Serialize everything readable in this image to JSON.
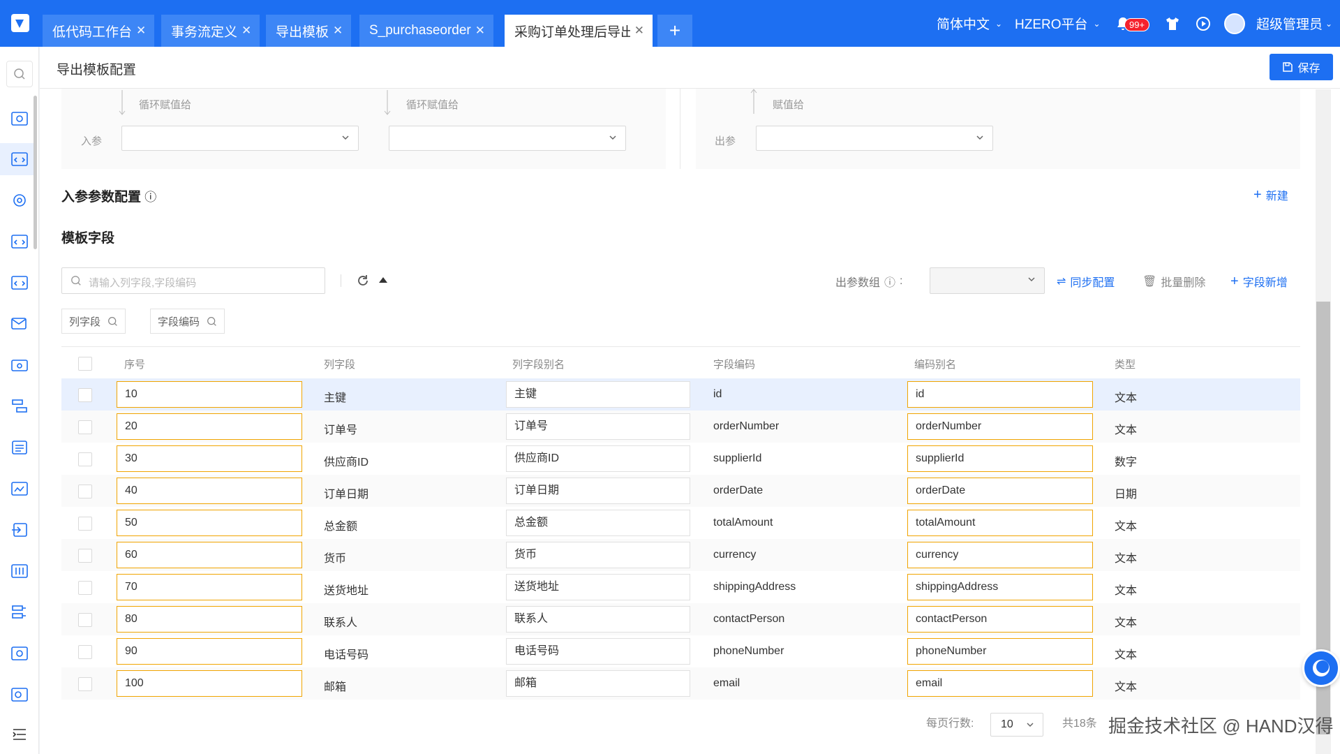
{
  "topbar": {
    "tabs": [
      {
        "label": "低代码工作台"
      },
      {
        "label": "事务流定义"
      },
      {
        "label": "导出模板"
      },
      {
        "label": "S_purchaseorder"
      },
      {
        "label": "采购订单处理后导出"
      }
    ],
    "language": "简体中文",
    "platform": "HZERO平台",
    "notification_count": "99+",
    "user": "超级管理员"
  },
  "header": {
    "title": "导出模板配置",
    "save_label": "保存"
  },
  "mapping": {
    "loop_assign_1": "循环赋值给",
    "loop_assign_2": "循环赋值给",
    "assign": "赋值给",
    "in_param": "入参",
    "out_param": "出参"
  },
  "in_params": {
    "title": "入参参数配置",
    "new_label": "新建"
  },
  "template_fields": {
    "title": "模板字段",
    "search_placeholder": "请输入列字段,字段编码",
    "output_group_label": "出参数组",
    "sync_label": "同步配置",
    "batch_delete_label": "批量删除",
    "add_field_label": "字段新增",
    "filter_chips": [
      "列字段",
      "字段编码"
    ],
    "columns": [
      "序号",
      "列字段",
      "列字段别名",
      "字段编码",
      "编码别名",
      "类型"
    ],
    "rows": [
      {
        "seq": "10",
        "col": "主键",
        "alias": "主键",
        "code": "id",
        "code_alias": "id",
        "type": "文本"
      },
      {
        "seq": "20",
        "col": "订单号",
        "alias": "订单号",
        "code": "orderNumber",
        "code_alias": "orderNumber",
        "type": "文本"
      },
      {
        "seq": "30",
        "col": "供应商ID",
        "alias": "供应商ID",
        "code": "supplierId",
        "code_alias": "supplierId",
        "type": "数字"
      },
      {
        "seq": "40",
        "col": "订单日期",
        "alias": "订单日期",
        "code": "orderDate",
        "code_alias": "orderDate",
        "type": "日期"
      },
      {
        "seq": "50",
        "col": "总金额",
        "alias": "总金额",
        "code": "totalAmount",
        "code_alias": "totalAmount",
        "type": "文本"
      },
      {
        "seq": "60",
        "col": "货币",
        "alias": "货币",
        "code": "currency",
        "code_alias": "currency",
        "type": "文本"
      },
      {
        "seq": "70",
        "col": "送货地址",
        "alias": "送货地址",
        "code": "shippingAddress",
        "code_alias": "shippingAddress",
        "type": "文本"
      },
      {
        "seq": "80",
        "col": "联系人",
        "alias": "联系人",
        "code": "contactPerson",
        "code_alias": "contactPerson",
        "type": "文本"
      },
      {
        "seq": "90",
        "col": "电话号码",
        "alias": "电话号码",
        "code": "phoneNumber",
        "code_alias": "phoneNumber",
        "type": "文本"
      },
      {
        "seq": "100",
        "col": "邮箱",
        "alias": "邮箱",
        "code": "email",
        "code_alias": "email",
        "type": "文本"
      }
    ]
  },
  "pager": {
    "rows_per_page_label": "每页行数:",
    "rows_per_page": "10",
    "total": "共18条"
  },
  "watermark": "掘金技术社区 @ HAND汉得",
  "colors": {
    "primary": "#1d6ff2",
    "input_border": "#f0a400",
    "selected_row": "#e8f0fe"
  }
}
